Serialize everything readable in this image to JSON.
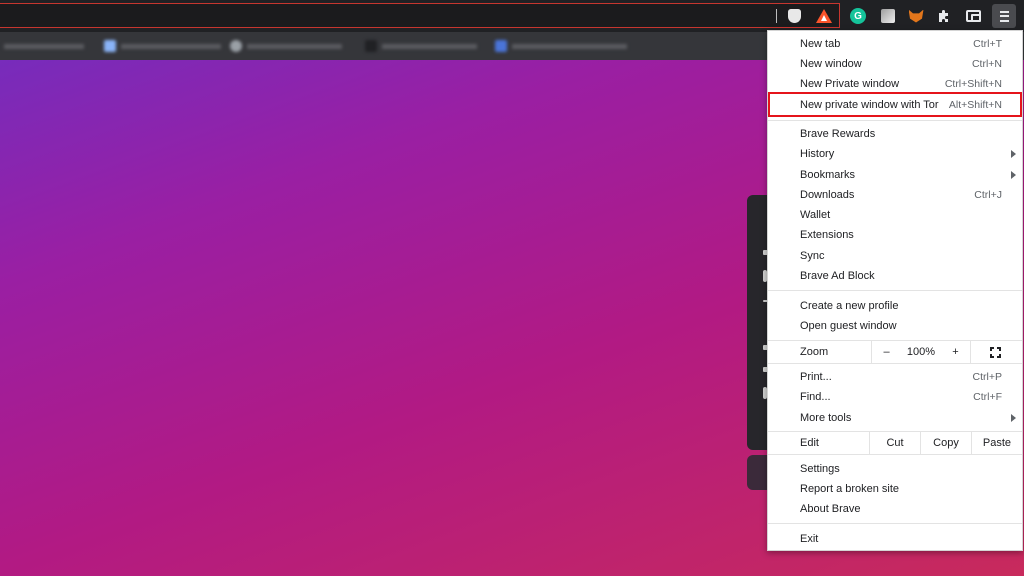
{
  "toolbar": {
    "extensions": [
      "brave-shields-icon",
      "brave-rewards-icon",
      "grammarly-icon",
      "extension-icon",
      "metamask-icon",
      "puzzle-icon",
      "wallet-icon"
    ],
    "menu_icon": "hamburger-menu-icon"
  },
  "bookmarks_bar": {
    "items": [
      "",
      "",
      "",
      "",
      "",
      ""
    ]
  },
  "menu": {
    "group1": [
      {
        "label": "New tab",
        "shortcut": "Ctrl+T"
      },
      {
        "label": "New window",
        "shortcut": "Ctrl+N"
      },
      {
        "label": "New Private window",
        "shortcut": "Ctrl+Shift+N"
      },
      {
        "label": "New private window with Tor",
        "shortcut": "Alt+Shift+N"
      }
    ],
    "group2": [
      {
        "label": "Brave Rewards",
        "shortcut": ""
      },
      {
        "label": "History",
        "shortcut": ""
      },
      {
        "label": "Bookmarks",
        "shortcut": ""
      },
      {
        "label": "Downloads",
        "shortcut": "Ctrl+J"
      },
      {
        "label": "Wallet",
        "shortcut": ""
      },
      {
        "label": "Extensions",
        "shortcut": ""
      },
      {
        "label": "Sync",
        "shortcut": ""
      },
      {
        "label": "Brave Ad Block",
        "shortcut": ""
      }
    ],
    "group3": [
      {
        "label": "Create a new profile"
      },
      {
        "label": "Open guest window"
      }
    ],
    "zoom": {
      "label": "Zoom",
      "minus": "–",
      "value": "100%",
      "plus": "+"
    },
    "group4": [
      {
        "label": "Print...",
        "shortcut": "Ctrl+P"
      },
      {
        "label": "Find...",
        "shortcut": "Ctrl+F"
      },
      {
        "label": "More tools",
        "shortcut": ""
      }
    ],
    "edit": {
      "label": "Edit",
      "cut": "Cut",
      "copy": "Copy",
      "paste": "Paste"
    },
    "group5": [
      {
        "label": "Settings"
      },
      {
        "label": "Report a broken site"
      },
      {
        "label": "About Brave"
      }
    ],
    "exit": {
      "label": "Exit"
    }
  },
  "colors": {
    "highlight_border": "#e5141b",
    "toolbar_bg": "#202124",
    "menu_bg": "#ffffff"
  }
}
